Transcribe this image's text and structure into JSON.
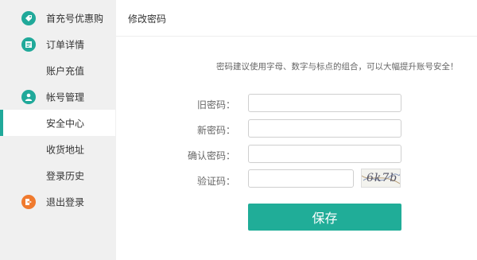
{
  "sidebar": {
    "items": [
      {
        "label": "首充号优惠购",
        "icon": "tag-icon",
        "icon_color": "#20a99a"
      },
      {
        "label": "订单详情",
        "icon": "order-list-icon",
        "icon_color": "#20a99a"
      },
      {
        "label": "账户充值"
      },
      {
        "label": "帐号管理",
        "icon": "user-icon",
        "icon_color": "#20a99a"
      },
      {
        "label": "安全中心"
      },
      {
        "label": "收货地址"
      },
      {
        "label": "登录历史"
      },
      {
        "label": "退出登录",
        "icon": "logout-icon",
        "icon_color": "#f07a2e"
      }
    ]
  },
  "main": {
    "title": "修改密码",
    "hint": "密码建议使用字母、数字与标点的组合，可以大幅提升账号安全！",
    "fields": {
      "old_password": {
        "label": "旧密码：",
        "value": ""
      },
      "new_password": {
        "label": "新密码：",
        "value": ""
      },
      "confirm_password": {
        "label": "确认密码：",
        "value": ""
      },
      "captcha": {
        "label": "验证码：",
        "value": "",
        "image_text": "6k7b"
      }
    },
    "save_label": "保存"
  },
  "colors": {
    "accent": "#20ad98",
    "logout": "#f07a2e",
    "background": "#f0f0f0"
  }
}
